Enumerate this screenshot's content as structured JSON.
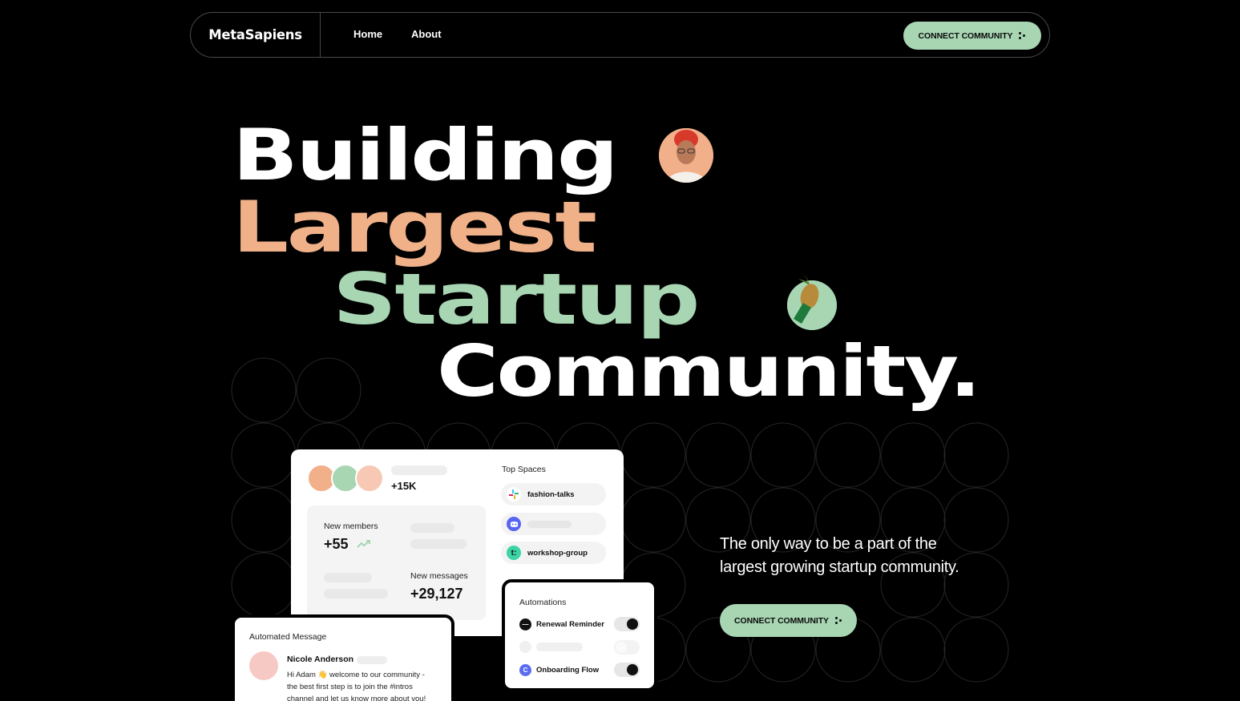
{
  "nav": {
    "brand": "MetaSapiens",
    "links": [
      "Home",
      "About"
    ],
    "cta_label": "CONNECT COMMUNITY"
  },
  "hero": {
    "line1": "Building",
    "line2": "Largest",
    "line3": "Startup",
    "line4": "Community.",
    "tagline": "The only way to be a part of the largest growing startup community.",
    "cta_label": "CONNECT COMMUNITY"
  },
  "stats_card": {
    "member_count": "+15K",
    "new_members_label": "New members",
    "new_members_value": "+55",
    "new_messages_label": "New messages",
    "new_messages_value": "+29,127",
    "top_spaces_title": "Top Spaces",
    "spaces": [
      "fashion-talks",
      "",
      "workshop-group"
    ]
  },
  "automations_card": {
    "title": "Automations",
    "items": [
      {
        "label": "Renewal Reminder",
        "enabled": true
      },
      {
        "label": "",
        "enabled": false
      },
      {
        "label": "Onboarding Flow",
        "enabled": true
      }
    ]
  },
  "message_card": {
    "title": "Automated Message",
    "sender": "Nicole Anderson",
    "text": "Hi Adam 👋 welcome to our community - the best first step is to join the #intros channel and let us know more about you!"
  },
  "colors": {
    "accent_green": "#a8d6b3",
    "accent_peach": "#f0b189",
    "background": "#000000"
  },
  "icons": [
    "arrow-dots-icon",
    "slack-icon",
    "discord-icon",
    "tribe-icon",
    "trend-up-icon",
    "notion-icon",
    "calendly-icon"
  ]
}
